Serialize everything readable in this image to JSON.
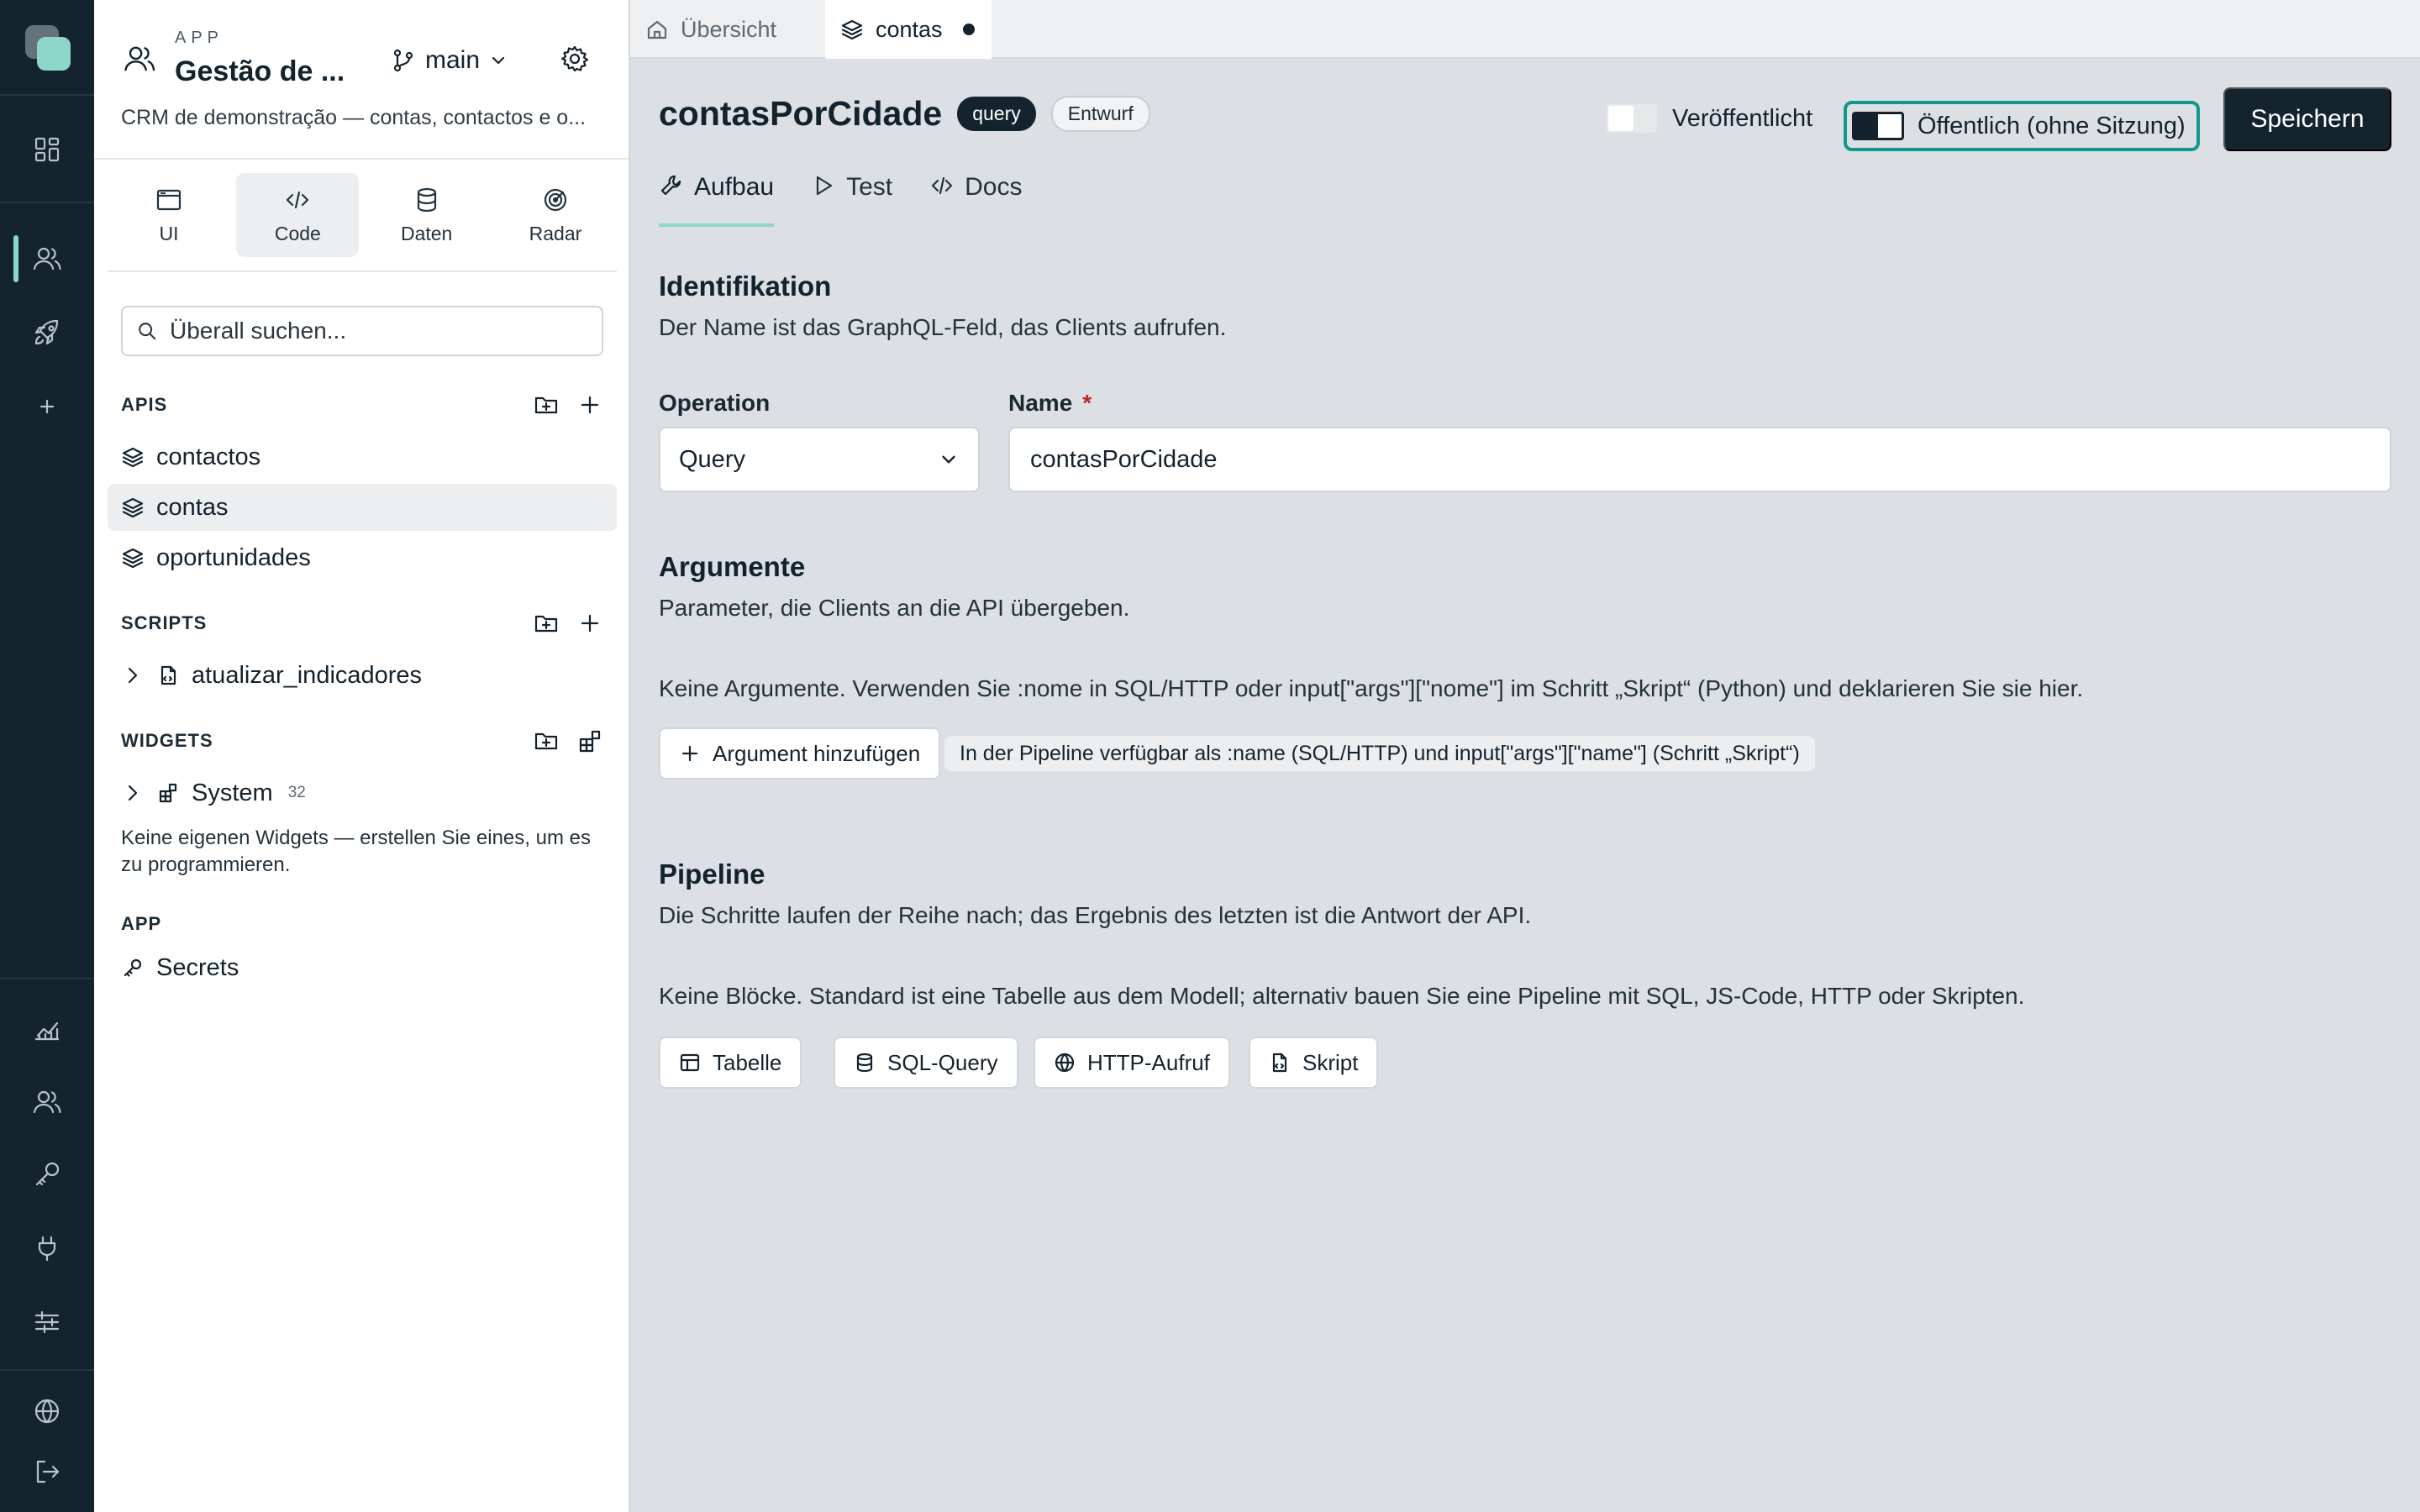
{
  "app": {
    "kicker": "APP",
    "title": "Gestão de ...",
    "description": "CRM de demonstração — contas, contactos e o...",
    "branch": "main"
  },
  "modes": [
    {
      "label": "UI",
      "icon": "browser-window-icon"
    },
    {
      "label": "Code",
      "icon": "code-icon"
    },
    {
      "label": "Daten",
      "icon": "database-icon"
    },
    {
      "label": "Radar",
      "icon": "radar-icon"
    }
  ],
  "active_mode": "Code",
  "search": {
    "placeholder": "Überall suchen..."
  },
  "sidebar": {
    "apis": {
      "title": "APIS",
      "items": [
        {
          "label": "contactos"
        },
        {
          "label": "contas",
          "active": true
        },
        {
          "label": "oportunidades"
        }
      ]
    },
    "scripts": {
      "title": "SCRIPTS",
      "items": [
        {
          "label": "atualizar_indicadores"
        }
      ]
    },
    "widgets": {
      "title": "WIDGETS",
      "items": [
        {
          "label": "System",
          "count": "32"
        }
      ],
      "note": "Keine eigenen Widgets — erstellen Sie eines, um es zu programmieren."
    },
    "app_section": {
      "title": "APP",
      "items": [
        {
          "label": "Secrets"
        }
      ]
    }
  },
  "tabs": [
    {
      "label": "Übersicht",
      "active": false
    },
    {
      "label": "contas",
      "active": true,
      "unsaved": true
    }
  ],
  "editor": {
    "title": "contasPorCidade",
    "type_badge": "query",
    "status_badge": "Entwurf",
    "published_label": "Veröffentlicht",
    "published": false,
    "public_label": "Öffentlich (ohne Sitzung)",
    "public": true,
    "save_label": "Speichern",
    "subtabs": [
      {
        "label": "Aufbau",
        "active": true
      },
      {
        "label": "Test",
        "active": false
      },
      {
        "label": "Docs",
        "active": false
      }
    ],
    "identification": {
      "title": "Identifikation",
      "description": "Der Name ist das GraphQL-Feld, das Clients aufrufen.",
      "operation_label": "Operation",
      "operation_value": "Query",
      "name_label": "Name",
      "required_mark": "*",
      "name_value": "contasPorCidade"
    },
    "arguments": {
      "title": "Argumente",
      "description": "Parameter, die Clients an die API übergeben.",
      "empty_text": "Keine Argumente. Verwenden Sie :nome in SQL/HTTP oder input[\"args\"][\"nome\"] im Schritt „Skript“ (Python) und deklarieren Sie sie hier.",
      "add_label": "Argument hinzufügen",
      "hint": "In der Pipeline verfügbar als :name (SQL/HTTP) und input[\"args\"][\"name\"] (Schritt „Skript“)"
    },
    "pipeline": {
      "title": "Pipeline",
      "description": "Die Schritte laufen der Reihe nach; das Ergebnis des letzten ist die Antwort der API.",
      "empty_text": "Keine Blöcke. Standard ist eine Tabelle aus dem Modell; alternativ bauen Sie eine Pipeline mit SQL, JS-Code, HTTP oder Skripten.",
      "blocks": [
        {
          "label": "Tabelle",
          "icon": "table-icon"
        },
        {
          "label": "SQL-Query",
          "icon": "database-icon"
        },
        {
          "label": "HTTP-Aufruf",
          "icon": "globe-icon"
        },
        {
          "label": "Skript",
          "icon": "script-file-icon"
        }
      ]
    }
  },
  "colors": {
    "rail_bg": "#13242f",
    "accent": "#8ed6c8",
    "focus_ring": "#14978a",
    "primary_button": "#14242f",
    "required": "#c0262d"
  }
}
